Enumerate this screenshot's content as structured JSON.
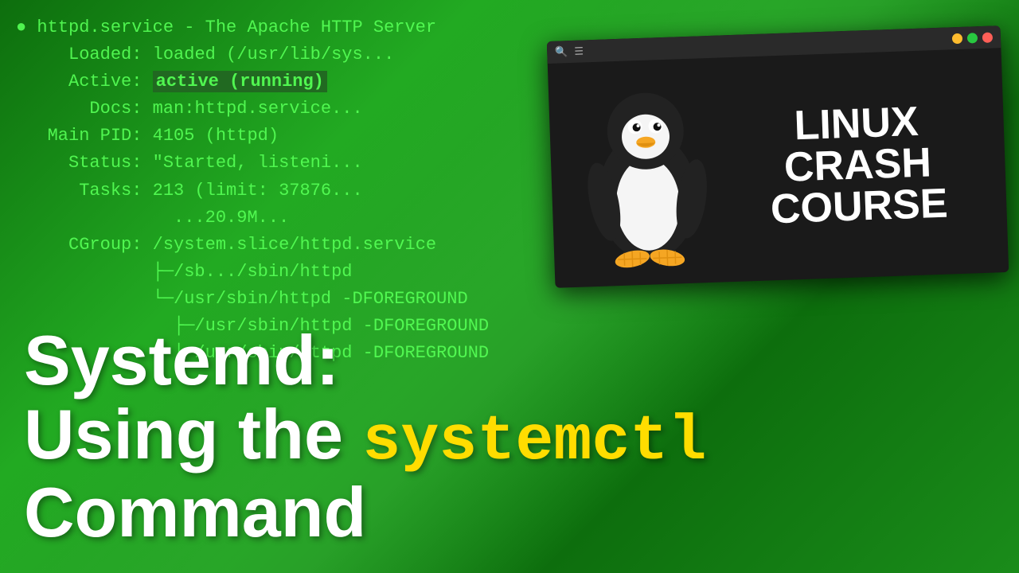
{
  "background": {
    "color_primary": "#1a8c1a",
    "color_secondary": "#0d6e0d"
  },
  "terminal": {
    "line1": "● httpd.service - The Apache HTTP Server",
    "line2_label": "     Loaded:",
    "line2_value": " loaded (/usr/lib/sys...",
    "line3_label": "     Active:",
    "line3_value": " active (running)",
    "line4_label": "       Docs:",
    "line4_value": " man:httpd.service...",
    "line5_label": "   Main PID:",
    "line5_value": " 4105 (httpd)",
    "line6_label": "     Status:",
    "line6_value": " \"Started, listeni...",
    "line7_label": "      Tasks:",
    "line7_value": " 213 (limit: 37876...",
    "line8_value": "        ..20.9M...",
    "line9_value": "   CGroup: /system.slice/httpd.service",
    "line10_value": "           ├─/sb... /sbin/httpd",
    "line11_value": "           └─/usr/sbin/httpd -DFOREGROUND",
    "line12_value": "             ├─/usr/sbin/httpd -DFOREGROUND",
    "line13_value": "             └─/usr/sbin/httpd -DFOREGROUND"
  },
  "title": {
    "line1": "Systemd:",
    "line2_plain": "Using the ",
    "line2_highlight": "systemctl",
    "line3": "Command"
  },
  "window": {
    "title": "",
    "lcc_line1": "LINUX",
    "lcc_line2": "CRASH",
    "lcc_line3": "COURSE"
  },
  "titlebar": {
    "search_icon": "🔍",
    "menu_icon": "☰",
    "min_icon": "−",
    "max_icon": "□",
    "close_icon": "×"
  }
}
